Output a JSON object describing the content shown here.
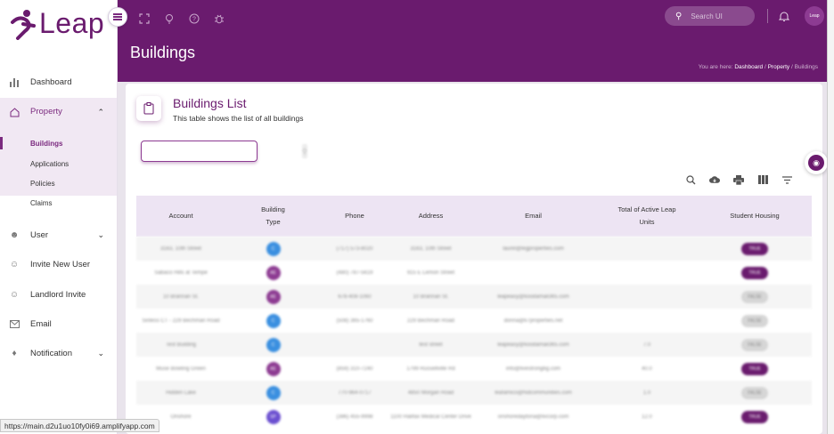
{
  "app": {
    "logo_text": "Leap",
    "brand_color": "#6a1b6e"
  },
  "sidebar": {
    "items": [
      {
        "label": "Dashboard",
        "icon": "bar-chart-icon"
      },
      {
        "label": "Property",
        "icon": "home-icon",
        "expanded": true,
        "children": [
          {
            "label": "Buildings",
            "active": true
          },
          {
            "label": "Applications"
          },
          {
            "label": "Policies"
          },
          {
            "label": "Claims"
          }
        ]
      },
      {
        "label": "User",
        "icon": "users-icon",
        "expandable": true
      },
      {
        "label": "Invite New User",
        "icon": "user-plus-icon"
      },
      {
        "label": "Landlord Invite",
        "icon": "user-plus-icon"
      },
      {
        "label": "Email",
        "icon": "mail-icon"
      },
      {
        "label": "Notification",
        "icon": "bell-icon",
        "expandable": true
      }
    ]
  },
  "header": {
    "search_placeholder": "Search UI",
    "avatar_text": "Leap",
    "page_title": "Buildings",
    "breadcrumb": {
      "prefix": "You are here:",
      "items": [
        "Dashboard",
        "Property",
        "Buildings"
      ],
      "sep": "/"
    }
  },
  "card": {
    "title": "Buildings List",
    "subtitle": "This table shows the list of all buildings"
  },
  "table": {
    "columns": [
      "Account",
      "Building Type",
      "Phone",
      "Address",
      "Email",
      "Total of Active Leap Units",
      "Student Housing"
    ],
    "rows": [
      {
        "account": "3163, 10th Street",
        "type": "C",
        "type_class": "c",
        "phone": "(717) 573-8020",
        "address": "3163, 10th Street",
        "email": "laurel@legproperties.com",
        "units": "",
        "sh": "TRUE",
        "sh_class": "yes"
      },
      {
        "account": "Sabaco Hills at Tempe",
        "type": "AE",
        "type_class": "ae",
        "phone": "(480) 787-5619",
        "address": "915 E Lemon Street",
        "email": "",
        "units": "",
        "sh": "TRUE",
        "sh_class": "yes"
      },
      {
        "account": "10 Brannan St.",
        "type": "AE",
        "type_class": "ae",
        "phone": "678-408-1060",
        "address": "10 Brannan St.",
        "email": "leapeasy@koodamail365.com",
        "units": "",
        "sh": "FALSE",
        "sh_class": "no"
      },
      {
        "account": "Sinless CT - 229 Bechman Road",
        "type": "C",
        "type_class": "c",
        "phone": "(508) 365-1760",
        "address": "229 Bechman Road",
        "email": "donna@k7properties.net",
        "units": "",
        "sh": "FALSE",
        "sh_class": "no"
      },
      {
        "account": "Test Building",
        "type": "C",
        "type_class": "c",
        "phone": "",
        "address": "test street",
        "email": "leapeasy@koodamail365.com",
        "units": "7.0",
        "sh": "FALSE",
        "sh_class": "no"
      },
      {
        "account": "Muse Bowling Green",
        "type": "AE",
        "type_class": "ae",
        "phone": "(859) 310-7240",
        "address": "1799 Russellville Rd",
        "email": "info@livestrongbg.com",
        "units": "40.0",
        "sh": "TRUE",
        "sh_class": "yes"
      },
      {
        "account": "Hidden Lake",
        "type": "C",
        "type_class": "c",
        "phone": "770-964-0717",
        "address": "4850 Morgan Road",
        "email": "leafamico@hidcommunities.com",
        "units": "1.0",
        "sh": "FALSE",
        "sh_class": "no"
      },
      {
        "account": "Onshore",
        "type": "SP",
        "type_class": "sp",
        "phone": "(386) 455-9998",
        "address": "1100 Halifax Medical Center Drive",
        "email": "onshoredaytona@livcorp.com",
        "units": "12.0",
        "sh": "TRUE",
        "sh_class": "yes"
      }
    ]
  },
  "status_bar_url": "https://main.d2u1uo10fy0i69.amplifyapp.com"
}
